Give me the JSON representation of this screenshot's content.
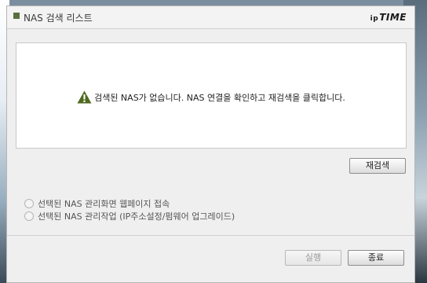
{
  "window": {
    "title": "NAS 검색 리스트",
    "brand_ip": "ip",
    "brand_name": "TIME"
  },
  "message": {
    "icon": "warning-icon",
    "text": "검색된 NAS가 없습니다. NAS 연결을 확인하고 재검색을 클릭합니다."
  },
  "buttons": {
    "rescan": "재검색",
    "run": "실행",
    "close": "종료"
  },
  "options": [
    {
      "label": "선택된 NAS 관리화면 웹페이지 접속",
      "selected": false
    },
    {
      "label": "선택된 NAS 관리작업 (IP주소설정/펌웨어 업그레이드)",
      "selected": false
    }
  ],
  "colors": {
    "accent": "#5a6f3e",
    "warning": "#4f6a1f"
  }
}
